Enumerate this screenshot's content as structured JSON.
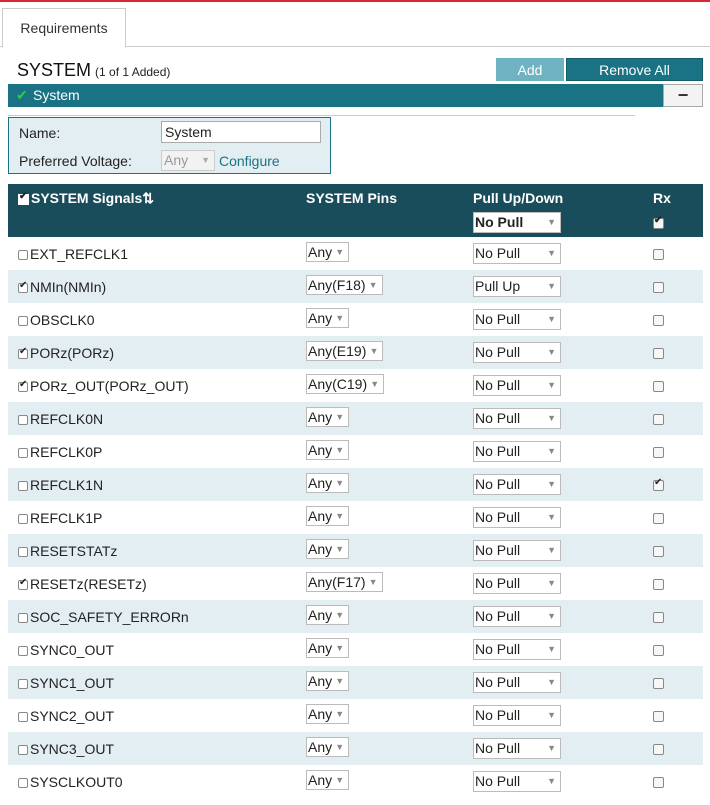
{
  "tab": {
    "label": "Requirements"
  },
  "header": {
    "title": "SYSTEM",
    "count": "(1 of 1 Added)"
  },
  "buttons": {
    "add": "Add",
    "remove_all": "Remove All"
  },
  "system_bar": {
    "label": "System",
    "collapse": "−"
  },
  "config": {
    "name_label": "Name:",
    "name_value": "System",
    "voltage_label": "Preferred Voltage:",
    "voltage_value": "Any",
    "configure": "Configure"
  },
  "table": {
    "headers": {
      "signals": "SYSTEM Signals",
      "sort_icon": "⇅",
      "pins": "SYSTEM Pins",
      "pull": "Pull Up/Down",
      "rx": "Rx",
      "pull_all_value": "No Pull"
    },
    "rows": [
      {
        "checked": false,
        "name": "EXT_REFCLK1",
        "pin": "Any",
        "pull": "No Pull",
        "rx": false
      },
      {
        "checked": true,
        "name": "NMIn(NMIn)",
        "pin": "Any(F18)",
        "pull": "Pull Up",
        "rx": false
      },
      {
        "checked": false,
        "name": "OBSCLK0",
        "pin": "Any",
        "pull": "No Pull",
        "rx": false
      },
      {
        "checked": true,
        "name": "PORz(PORz)",
        "pin": "Any(E19)",
        "pull": "No Pull",
        "rx": false
      },
      {
        "checked": true,
        "name": "PORz_OUT(PORz_OUT)",
        "pin": "Any(C19)",
        "pull": "No Pull",
        "rx": false
      },
      {
        "checked": false,
        "name": "REFCLK0N",
        "pin": "Any",
        "pull": "No Pull",
        "rx": false
      },
      {
        "checked": false,
        "name": "REFCLK0P",
        "pin": "Any",
        "pull": "No Pull",
        "rx": false
      },
      {
        "checked": false,
        "name": "REFCLK1N",
        "pin": "Any",
        "pull": "No Pull",
        "rx": true
      },
      {
        "checked": false,
        "name": "REFCLK1P",
        "pin": "Any",
        "pull": "No Pull",
        "rx": false
      },
      {
        "checked": false,
        "name": "RESETSTATz",
        "pin": "Any",
        "pull": "No Pull",
        "rx": false
      },
      {
        "checked": true,
        "name": "RESETz(RESETz)",
        "pin": "Any(F17)",
        "pull": "No Pull",
        "rx": false
      },
      {
        "checked": false,
        "name": "SOC_SAFETY_ERRORn",
        "pin": "Any",
        "pull": "No Pull",
        "rx": false
      },
      {
        "checked": false,
        "name": "SYNC0_OUT",
        "pin": "Any",
        "pull": "No Pull",
        "rx": false
      },
      {
        "checked": false,
        "name": "SYNC1_OUT",
        "pin": "Any",
        "pull": "No Pull",
        "rx": false
      },
      {
        "checked": false,
        "name": "SYNC2_OUT",
        "pin": "Any",
        "pull": "No Pull",
        "rx": false
      },
      {
        "checked": false,
        "name": "SYNC3_OUT",
        "pin": "Any",
        "pull": "No Pull",
        "rx": false
      },
      {
        "checked": false,
        "name": "SYSCLKOUT0",
        "pin": "Any",
        "pull": "No Pull",
        "rx": false
      }
    ]
  }
}
